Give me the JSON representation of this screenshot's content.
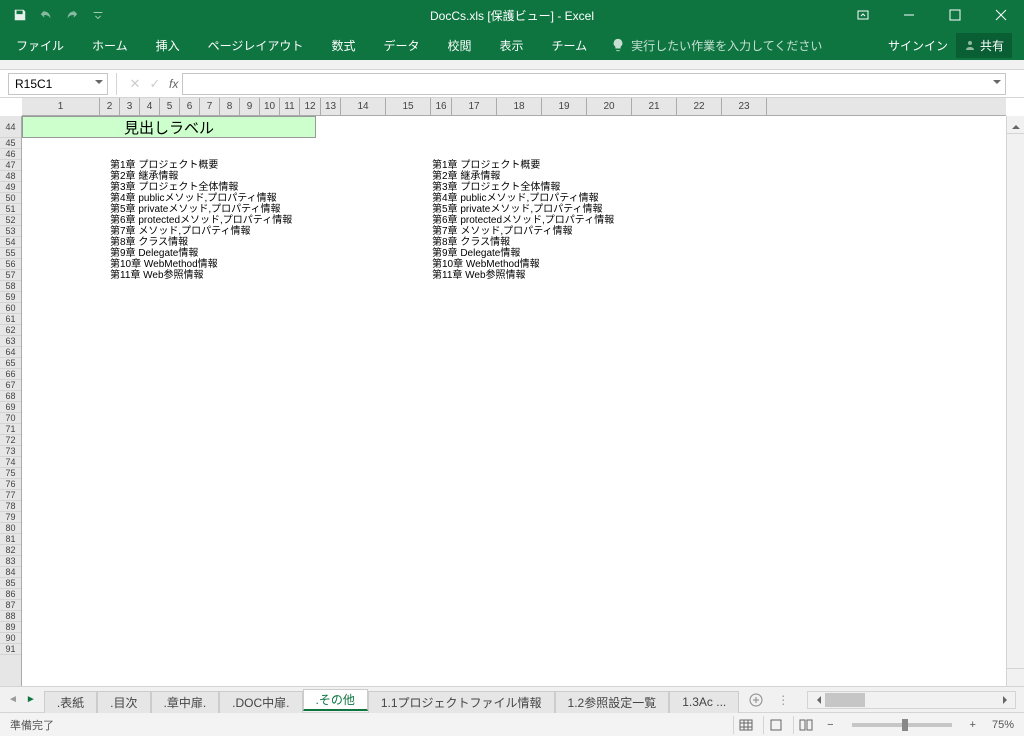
{
  "title": "DocCs.xls [保護ビュー] - Excel",
  "qat": {
    "save": "save",
    "undo": "undo",
    "redo": "redo",
    "custom": "customize"
  },
  "ribbon": {
    "tabs": [
      "ファイル",
      "ホーム",
      "挿入",
      "ページレイアウト",
      "数式",
      "データ",
      "校閲",
      "表示",
      "チーム"
    ],
    "tellme": "実行したい作業を入力してください",
    "signin": "サインイン",
    "share": "共有"
  },
  "namebox": "R15C1",
  "cols": [
    "1",
    "2",
    "3",
    "4",
    "5",
    "6",
    "7",
    "8",
    "9",
    "10",
    "11",
    "12",
    "13",
    "14",
    "15",
    "16",
    "17",
    "18",
    "19",
    "20",
    "21",
    "22",
    "23"
  ],
  "rows": [
    "44",
    "45",
    "46",
    "47",
    "48",
    "49",
    "50",
    "51",
    "52",
    "53",
    "54",
    "55",
    "56",
    "57",
    "58",
    "59",
    "60",
    "61",
    "62",
    "63",
    "64",
    "65",
    "66",
    "67",
    "68",
    "69",
    "70",
    "71",
    "72",
    "73",
    "74",
    "75",
    "76",
    "77",
    "78",
    "79",
    "80",
    "81",
    "82",
    "83",
    "84",
    "85",
    "86",
    "87",
    "88",
    "89",
    "90",
    "91"
  ],
  "header_label": "見出しラベル",
  "chapters_left": [
    "第1章 プロジェクト概要",
    "第2章 継承情報",
    "第3章 プロジェクト全体情報",
    "第4章 publicメソッド,プロパティ情報",
    "第5章 privateメソッド,プロパティ情報",
    "第6章 protectedメソッド,プロパティ情報",
    "第7章 メソッド,プロパティ情報",
    "第8章 クラス情報",
    "第9章 Delegate情報",
    "第10章 WebMethod情報",
    "第11章 Web参照情報"
  ],
  "chapters_right": [
    "第1章 プロジェクト概要",
    "第2章 継承情報",
    "第3章 プロジェクト全体情報",
    "第4章 publicメソッド,プロパティ情報",
    "第5章 privateメソッド,プロパティ情報",
    "第6章 protectedメソッド,プロパティ情報",
    "第7章 メソッド,プロパティ情報",
    "第8章 クラス情報",
    "第9章 Delegate情報",
    "第10章 WebMethod情報",
    "第11章 Web参照情報"
  ],
  "sheets": [
    ".表紙",
    ".目次",
    ".章中扉.",
    ".DOC中扉.",
    ".その他",
    "1.1プロジェクトファイル情報",
    "1.2参照設定一覧",
    "1.3Ac ..."
  ],
  "active_sheet": 4,
  "status": "準備完了",
  "zoom": "75%"
}
